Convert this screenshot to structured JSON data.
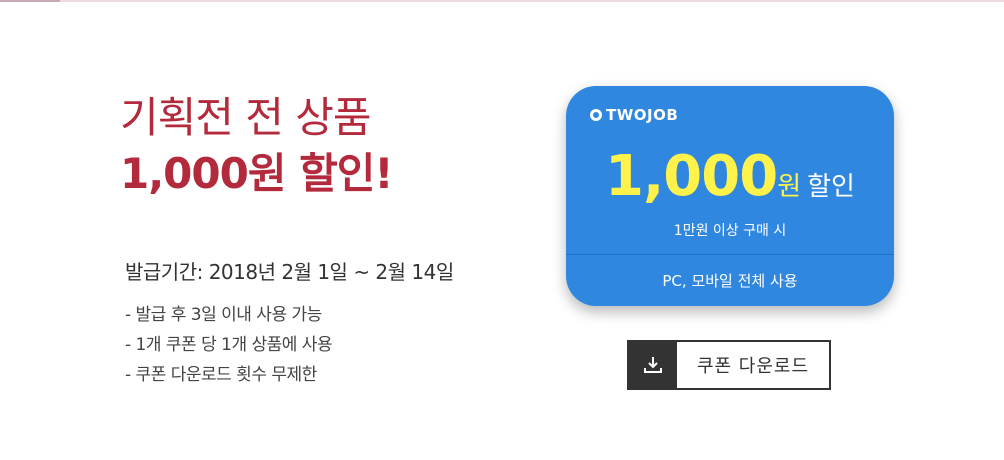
{
  "promo": {
    "headline_line1": "기획전 전 상품",
    "headline_line2": "1,000원 할인!"
  },
  "info": {
    "period": "발급기간: 2018년 2월 1일 ~ 2월 14일",
    "notes": [
      "- 발급 후 3일 이내 사용 가능",
      "- 1개 쿠폰 당 1개 상품에 사용",
      "- 쿠폰 다운로드 횟수 무제한"
    ]
  },
  "coupon": {
    "brand": "TWOJOB",
    "amount": "1,000",
    "unit": "원",
    "discount_label": "할인",
    "condition": "1만원 이상 구매 시",
    "usage": "PC, 모바일 전체 사용",
    "colors": {
      "background": "#2f87e0",
      "amount": "#fff24a"
    }
  },
  "download": {
    "label": "쿠폰 다운로드",
    "icon": "download-icon"
  },
  "colors": {
    "headline": "#b32a3c"
  }
}
